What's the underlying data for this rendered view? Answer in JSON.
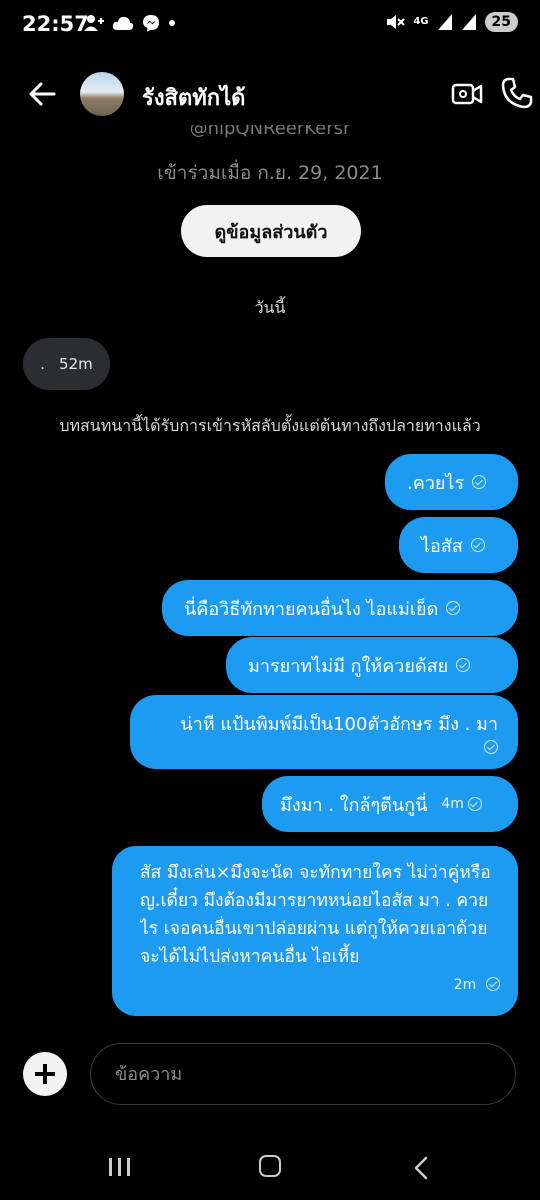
{
  "status_bar": {
    "time": "22:57",
    "battery": "25",
    "network": "4G",
    "icons_left": [
      "person-add-icon",
      "cloud-icon",
      "messenger-icon",
      "dot-icon"
    ],
    "icons_right": [
      "mute-icon",
      "network-4g-icon",
      "signal-icon",
      "signal-icon",
      "battery-icon"
    ]
  },
  "header": {
    "contact_name": "รังสิตทักได้",
    "back_icon": "arrow-left-icon",
    "video_icon": "video-call-icon",
    "call_icon": "phone-icon"
  },
  "profile": {
    "handle": "@hipQNReerKersr",
    "joined": "เข้าร่วมเมื่อ ก.ย. 29, 2021",
    "view_profile_label": "ดูข้อมูลส่วนตัว"
  },
  "date_separator": "วันนี้",
  "received_message": {
    "text": ".",
    "time": "52m"
  },
  "encryption_notice": "บทสนทนานี้ได้รับการเข้ารหัสลับตั้งแต่ต้นทางถึงปลายทางแล้ว",
  "sent_messages": [
    {
      "text": ".ควยไร",
      "time": ""
    },
    {
      "text": "ไอสัส",
      "time": ""
    },
    {
      "text": "นี่คือวิธีทักทายคนอื่นไง ไอแม่เย็ด",
      "time": ""
    },
    {
      "text": "มารยาทไม่มี กูให้ควยด้สย",
      "time": ""
    },
    {
      "text": "น่าหี แป้นพิมพ์มีเป็น100ตัวอักษร มึง . มา",
      "time": ""
    },
    {
      "text": "มึงมา . ใกล้ๆตีนกูนี่",
      "time": "4m"
    },
    {
      "text": "สัส มึงเล่น×มึงจะนัด จะทักทายใคร ไม่ว่าคู่หรือ ญ.เดี๋ยว มึงต้องมีมารยาทหน่อยไอสัส มา . ควยไร เจอคนอื่นเขาปล่อยผ่าน แต่กูให้ควยเอาด้วย จะได้ไม่ไปส่งหาคนอื่น ไอเหี้ย",
      "time": "2m"
    }
  ],
  "composer": {
    "placeholder": "ข้อความ",
    "add_icon": "plus-circle-icon"
  },
  "nav": {
    "recent_icon": "recent-apps-icon",
    "home_icon": "home-icon",
    "back_icon": "back-chevron-icon"
  },
  "colors": {
    "background": "#000000",
    "sent_bubble": "#1d9bf0",
    "received_bubble": "#2b2d31",
    "button": "#f2f2f2"
  }
}
